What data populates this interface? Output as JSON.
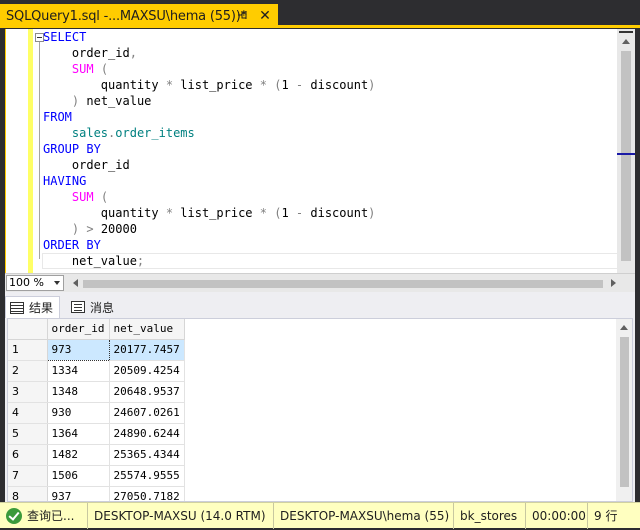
{
  "tab": {
    "title": "SQLQuery1.sql -...MAXSU\\hema (55))*",
    "close_glyph": "✕"
  },
  "editor": {
    "lines": [
      [
        {
          "t": "SELECT",
          "c": "kw"
        }
      ],
      [
        {
          "t": "    order_id",
          "c": "id"
        },
        {
          "t": ",",
          "c": "op"
        }
      ],
      [
        {
          "t": "    ",
          "c": "id"
        },
        {
          "t": "SUM",
          "c": "fn"
        },
        {
          "t": " (",
          "c": "op"
        }
      ],
      [
        {
          "t": "        quantity ",
          "c": "id"
        },
        {
          "t": "*",
          "c": "op"
        },
        {
          "t": " list_price ",
          "c": "id"
        },
        {
          "t": "*",
          "c": "op"
        },
        {
          "t": " (",
          "c": "op"
        },
        {
          "t": "1",
          "c": "id"
        },
        {
          "t": " -",
          "c": "op"
        },
        {
          "t": " discount",
          "c": "id"
        },
        {
          "t": ")",
          "c": "op"
        }
      ],
      [
        {
          "t": "    ",
          "c": "id"
        },
        {
          "t": ")",
          "c": "op"
        },
        {
          "t": " net_value",
          "c": "id"
        }
      ],
      [
        {
          "t": "FROM",
          "c": "kw"
        }
      ],
      [
        {
          "t": "    sales",
          "c": "obj"
        },
        {
          "t": ".",
          "c": "op"
        },
        {
          "t": "order_items",
          "c": "obj"
        }
      ],
      [
        {
          "t": "GROUP BY",
          "c": "kw"
        }
      ],
      [
        {
          "t": "    order_id",
          "c": "id"
        }
      ],
      [
        {
          "t": "HAVING",
          "c": "kw"
        }
      ],
      [
        {
          "t": "    ",
          "c": "id"
        },
        {
          "t": "SUM",
          "c": "fn"
        },
        {
          "t": " (",
          "c": "op"
        }
      ],
      [
        {
          "t": "        quantity ",
          "c": "id"
        },
        {
          "t": "*",
          "c": "op"
        },
        {
          "t": " list_price ",
          "c": "id"
        },
        {
          "t": "*",
          "c": "op"
        },
        {
          "t": " (",
          "c": "op"
        },
        {
          "t": "1",
          "c": "id"
        },
        {
          "t": " -",
          "c": "op"
        },
        {
          "t": " discount",
          "c": "id"
        },
        {
          "t": ")",
          "c": "op"
        }
      ],
      [
        {
          "t": "    ",
          "c": "id"
        },
        {
          "t": ")",
          "c": "op"
        },
        {
          "t": " >",
          "c": "op"
        },
        {
          "t": " 20000",
          "c": "id"
        }
      ],
      [
        {
          "t": "ORDER BY",
          "c": "kw"
        }
      ],
      [
        {
          "t": "    net_value",
          "c": "id"
        },
        {
          "t": ";",
          "c": "op"
        }
      ]
    ]
  },
  "zoom": {
    "value": "100 %"
  },
  "results_tabs": {
    "results": "结果",
    "messages": "消息"
  },
  "grid": {
    "columns": [
      "order_id",
      "net_value"
    ],
    "rows": [
      [
        "1",
        "973",
        "20177.7457"
      ],
      [
        "2",
        "1334",
        "20509.4254"
      ],
      [
        "3",
        "1348",
        "20648.9537"
      ],
      [
        "4",
        "930",
        "24607.0261"
      ],
      [
        "5",
        "1364",
        "24890.6244"
      ],
      [
        "6",
        "1482",
        "25365.4344"
      ],
      [
        "7",
        "1506",
        "25574.9555"
      ],
      [
        "8",
        "937",
        "27050.7182"
      ]
    ]
  },
  "status": {
    "state": "查询已...",
    "server": "DESKTOP-MAXSU (14.0 RTM)",
    "login": "DESKTOP-MAXSU\\hema (55)",
    "database": "bk_stores",
    "elapsed": "00:00:00",
    "rows": "9 行"
  }
}
